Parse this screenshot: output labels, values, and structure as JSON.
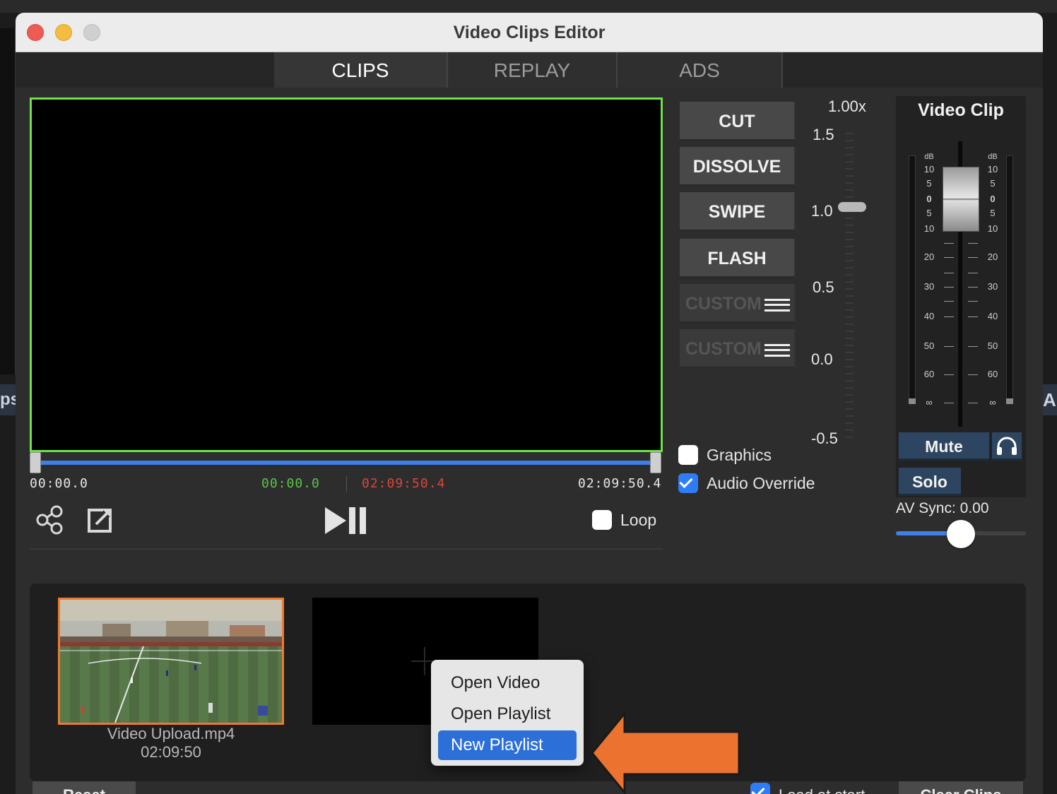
{
  "window": {
    "title": "Video Clips Editor"
  },
  "background": {
    "left_fragment": "ps",
    "right_fragment": "A"
  },
  "tabs": [
    {
      "label": "CLIPS",
      "active": true
    },
    {
      "label": "REPLAY",
      "active": false
    },
    {
      "label": "ADS",
      "active": false
    }
  ],
  "preview": {
    "timecode_start": "00:00.0",
    "timecode_in": "00:00.0",
    "timecode_out": "02:09:50.4",
    "timecode_end": "02:09:50.4",
    "loop_label": "Loop",
    "loop_checked": false
  },
  "transitions": [
    {
      "label": "CUT",
      "enabled": true
    },
    {
      "label": "DISSOLVE",
      "enabled": true
    },
    {
      "label": "SWIPE",
      "enabled": true
    },
    {
      "label": "FLASH",
      "enabled": true
    },
    {
      "label": "CUSTOM",
      "enabled": false
    },
    {
      "label": "CUSTOM",
      "enabled": false
    }
  ],
  "speed": {
    "value_label": "1.00x",
    "value": 1.0,
    "ticks": [
      "1.5",
      "1.0",
      "0.5",
      "0.0",
      "-0.5"
    ]
  },
  "options": {
    "graphics_label": "Graphics",
    "graphics_checked": false,
    "audio_override_label": "Audio Override",
    "audio_override_checked": true
  },
  "audio": {
    "title": "Video Clip",
    "scale_unit": "dB",
    "scale": [
      "10",
      "5",
      "0",
      "5",
      "10",
      "20",
      "30",
      "40",
      "50",
      "60",
      "∞"
    ],
    "mute_label": "Mute",
    "solo_label": "Solo",
    "headphones_icon": "headphones-icon",
    "av_sync_label": "AV Sync: 0.00",
    "av_sync_value": 0.5
  },
  "clips": [
    {
      "name": "Video Upload.mp4",
      "duration": "02:09:50",
      "selected": true
    }
  ],
  "context_menu": {
    "items": [
      {
        "label": "Open Video",
        "highlighted": false
      },
      {
        "label": "Open Playlist",
        "highlighted": false
      },
      {
        "label": "New Playlist",
        "highlighted": true
      }
    ]
  },
  "bottom": {
    "reset_label": "Reset",
    "load_at_start_label": "Load at start",
    "load_at_start_checked": true,
    "clear_clips_label": "Clear Clips"
  },
  "colors": {
    "accent_blue": "#3f7fe6",
    "preview_border": "#6ee24a",
    "selection_orange": "#ee7a2e",
    "arrow_orange": "#ec7230",
    "timecode_in": "#5ec24a",
    "timecode_out": "#d9473a",
    "menu_highlight": "#2c6fd8"
  }
}
